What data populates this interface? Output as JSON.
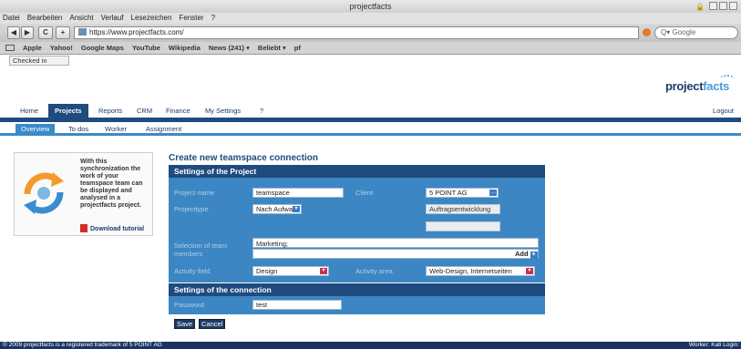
{
  "window": {
    "title": "projectfacts"
  },
  "menu": [
    "Datei",
    "Bearbeiten",
    "Ansicht",
    "Verlauf",
    "Lesezeichen",
    "Fenster",
    "?"
  ],
  "toolbar": {
    "url": "https://www.projectfacts.com/",
    "search_placeholder": "Google",
    "back": "◀",
    "forward": "▶",
    "reload": "C",
    "add": "+"
  },
  "bookmarks": [
    "Apple",
    "Yahoo!",
    "Google Maps",
    "YouTube",
    "Wikipedia",
    "News (241) ▾",
    "Beliebt ▾",
    "pf"
  ],
  "app": {
    "checked_in": "Checked in",
    "logo_main": "project",
    "logo_accent": "facts",
    "main_nav": [
      "Home",
      "Projects",
      "Reports",
      "CRM",
      "Finance",
      "My Settings",
      "?"
    ],
    "logout": "Logout",
    "sub_nav": [
      "Overview",
      "To dos",
      "Worker",
      "Assignment"
    ]
  },
  "info": {
    "text": "With this synchronization the work of your teamspace team can be displayed and analysed in a projectfacts project.",
    "download": "Download tutorial"
  },
  "form": {
    "title": "Create new teamspace connection",
    "section_project": "Settings of the Project",
    "project_name_label": "Project name",
    "project_name_value": "teamspace",
    "client_label": "Client",
    "client_value": "5 POINT AG",
    "projecttype_label": "Projecttype",
    "projecttype_value": "Nach Aufwand",
    "auftrag_value": "Auftragsentwicklung",
    "team_label": "Selection of team members",
    "team_value": "Marketing;",
    "add_label": "Add",
    "activity_field_label": "Activity field",
    "activity_field_value": "Design",
    "activity_area_label": "Activity area",
    "activity_area_value": "Web-Design, Internetseiten",
    "section_connection": "Settings of the connection",
    "password_label": "Password",
    "password_value": "test",
    "save_label": "Save",
    "cancel_label": "Cancel"
  },
  "footer": {
    "copyright": "© 2009 projectfacts is a registered trademark of 5 POINT AG",
    "right": "Worker: Kati   Login:"
  }
}
